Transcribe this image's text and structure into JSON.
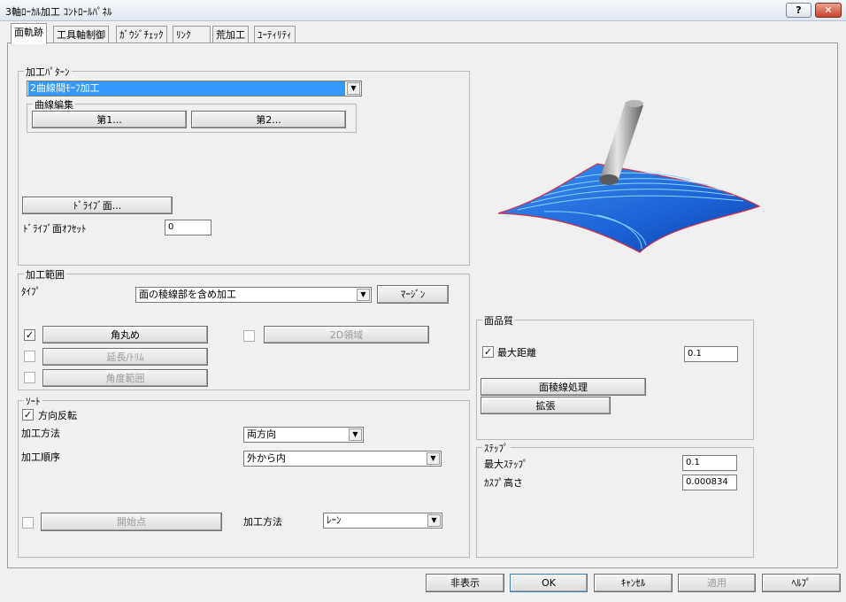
{
  "window": {
    "title": "3軸ﾛｰｶﾙ加工 ｺﾝﾄﾛｰﾙﾊﾟﾈﾙ",
    "help_button": "?",
    "close_button": "✕"
  },
  "tabs": [
    {
      "label": "面軌跡",
      "active": true
    },
    {
      "label": "工具軸制御"
    },
    {
      "label": "ｶﾞｳｼﾞﾁｪｯｸ"
    },
    {
      "label": "ﾘﾝｸ"
    },
    {
      "label": "荒加工"
    },
    {
      "label": "ﾕｰﾃｨﾘﾃｨ"
    }
  ],
  "pattern": {
    "legend": "加工ﾊﾟﾀｰﾝ",
    "selected": "2曲線間ﾓｰﾌ加工",
    "curve_edit_legend": "曲線編集",
    "first_button": "第1...",
    "second_button": "第2...",
    "drive_surface_button": "ﾄﾞﾗｲﾌﾞ面...",
    "drive_offset_label": "ﾄﾞﾗｲﾌﾞ面ｵﾌｾｯﾄ",
    "drive_offset_value": "0"
  },
  "range": {
    "legend": "加工範囲",
    "type_label": "ﾀｲﾌﾟ",
    "type_value": "面の稜線部を含め加工",
    "margin_button": "ﾏｰｼﾞﾝ",
    "corner_round": {
      "label": "角丸め",
      "checked": true
    },
    "extend_trim": {
      "label": "延長/ﾄﾘﾑ",
      "checked": false
    },
    "angle_range": {
      "label": "角度範囲",
      "checked": false
    },
    "region_2d": {
      "label": "2D領域",
      "checked": false
    }
  },
  "sort": {
    "legend": "ｿｰﾄ",
    "reverse_label": "方向反転",
    "reverse_checked": true,
    "method_label": "加工方法",
    "method_value": "両方向",
    "order_label": "加工順序",
    "order_value": "外から内",
    "start_point_button": "開始点",
    "start_point_checked": false,
    "method2_label": "加工方法",
    "method2_value": "ﾚｰﾝ"
  },
  "quality": {
    "legend": "面品質",
    "max_distance_label": "最大距離",
    "max_distance_checked": true,
    "max_distance_value": "0.1",
    "edge_button": "面稜線処理",
    "expand_button": "拡張"
  },
  "step": {
    "legend": "ｽﾃｯﾌﾟ",
    "max_step_label": "最大ｽﾃｯﾌﾟ",
    "max_step_value": "0.1",
    "cusp_label": "ｶｽﾌﾟ高さ",
    "cusp_value": "0.000834"
  },
  "footer": {
    "hide_button": "非表示",
    "ok_button": "OK",
    "cancel_button": "ｷｬﾝｾﾙ",
    "apply_button": "適用",
    "help_button": "ﾍﾙﾌﾟ"
  },
  "colors": {
    "surface": "#1f6fe0",
    "surface_edge": "#d0304a",
    "toolpath": "#8ad4ff",
    "selection": "#3399ff"
  }
}
